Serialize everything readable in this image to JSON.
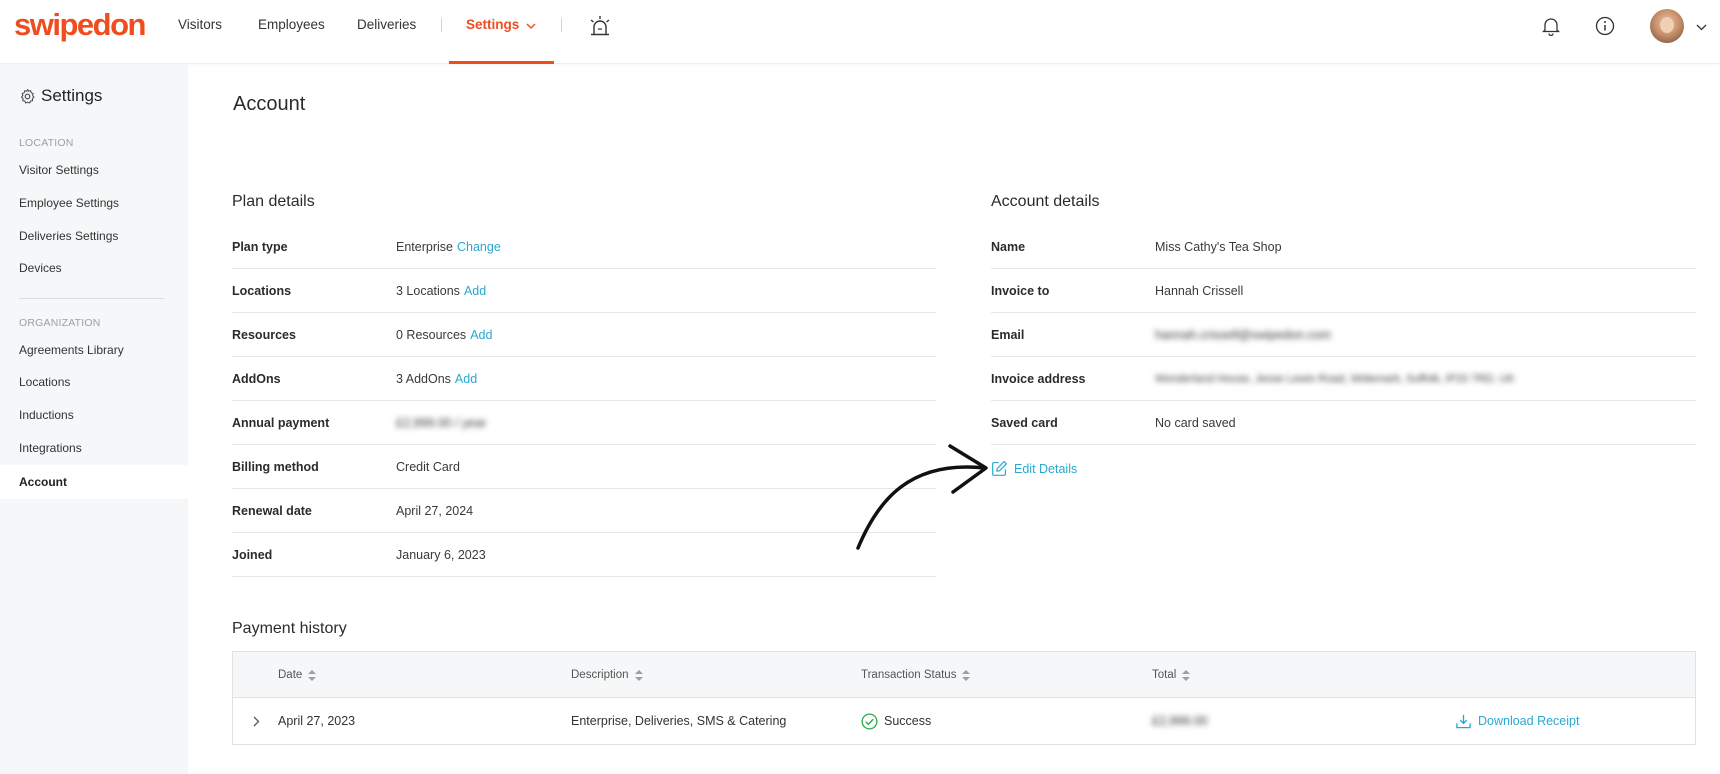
{
  "brand": {
    "name": "swipedon",
    "accent": "#ef4d1f",
    "link": "#29a8cf"
  },
  "nav": {
    "items": [
      "Visitors",
      "Employees",
      "Deliveries"
    ],
    "active": "Settings"
  },
  "sidebar": {
    "title": "Settings",
    "location_label": "LOCATION",
    "location_items": [
      "Visitor Settings",
      "Employee Settings",
      "Deliveries Settings",
      "Devices"
    ],
    "organization_label": "ORGANIZATION",
    "organization_items": [
      "Agreements Library",
      "Locations",
      "Inductions",
      "Integrations",
      "Account"
    ]
  },
  "page": {
    "title": "Account"
  },
  "plan": {
    "title": "Plan details",
    "rows": [
      {
        "label": "Plan type",
        "value": "Enterprise",
        "action": "Change"
      },
      {
        "label": "Locations",
        "value": "3 Locations",
        "action": "Add"
      },
      {
        "label": "Resources",
        "value": "0 Resources",
        "action": "Add"
      },
      {
        "label": "AddOns",
        "value": "3 AddOns",
        "action": "Add"
      },
      {
        "label": "Annual payment",
        "value": "£2,999.00 / year"
      },
      {
        "label": "Billing method",
        "value": "Credit Card"
      },
      {
        "label": "Renewal date",
        "value": "April 27, 2024"
      },
      {
        "label": "Joined",
        "value": "January 6, 2023"
      }
    ]
  },
  "account": {
    "title": "Account details",
    "rows": [
      {
        "label": "Name",
        "value": "Miss Cathy's Tea Shop"
      },
      {
        "label": "Invoice to",
        "value": "Hannah Crissell"
      },
      {
        "label": "Email",
        "value": "hannah.crissell@swipedon.com"
      },
      {
        "label": "Invoice address",
        "value": "Wonderland House, Jesse Lewis Road, Widemark, Suffolk, IP20 7RD, UK"
      },
      {
        "label": "Saved card",
        "value": "No card saved"
      }
    ],
    "edit_label": "Edit Details"
  },
  "payments": {
    "title": "Payment history",
    "columns": [
      "Date",
      "Description",
      "Transaction Status",
      "Total"
    ],
    "rows": [
      {
        "date": "April 27, 2023",
        "description": "Enterprise, Deliveries, SMS & Catering",
        "status": "Success",
        "total": "£2,999.00",
        "action": "Download Receipt"
      }
    ]
  },
  "icons": {
    "settings": "gear-icon",
    "alarm": "alarm-icon",
    "notifications": "bell-icon",
    "info": "info-icon",
    "avatar": "avatar",
    "edit": "edit-icon",
    "sort": "sort-icon",
    "expand": "chevron-right-icon",
    "success": "check-circle-icon",
    "download": "download-icon"
  }
}
